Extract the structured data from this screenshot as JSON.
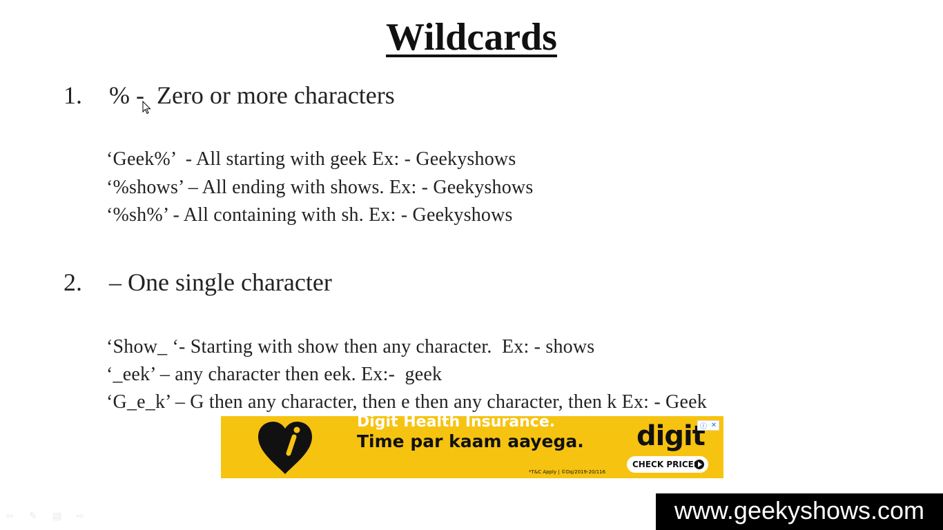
{
  "slide": {
    "title": "Wildcards",
    "sections": [
      {
        "number": "1.",
        "heading": "% -  Zero or more characters",
        "examples": [
          "‘Geek%’  - All starting with geek Ex: - Geekyshows",
          "‘%shows’ – All ending with shows. Ex: - Geekyshows",
          "‘%sh%’ - All containing with sh. Ex: - Geekyshows"
        ]
      },
      {
        "number": "2.",
        "heading": "– One single character",
        "examples": [
          "‘Show_ ‘- Starting with show then any character.  Ex: - shows",
          "‘_eek’ – any character then eek. Ex:-  geek",
          "‘G_e_k’ – G then any character, then e then any character, then k Ex: - Geek"
        ]
      }
    ]
  },
  "ad": {
    "line1": "Digit Health Insurance.",
    "line2": "Time par kaam aayega.",
    "brand": "digit",
    "cta": "CHECK PRICES",
    "fine_print": "*T&C Apply | ©Dq/2019-20/116",
    "background": "#f6c311"
  },
  "watermark": {
    "text": "www.geekyshows.com"
  },
  "icons": [
    "mouse-cursor-icon",
    "heart-logo-icon",
    "play-icon",
    "ad-info-icon",
    "ad-close-icon",
    "prev-slide-icon",
    "pen-icon",
    "menu-icon",
    "next-slide-icon"
  ]
}
